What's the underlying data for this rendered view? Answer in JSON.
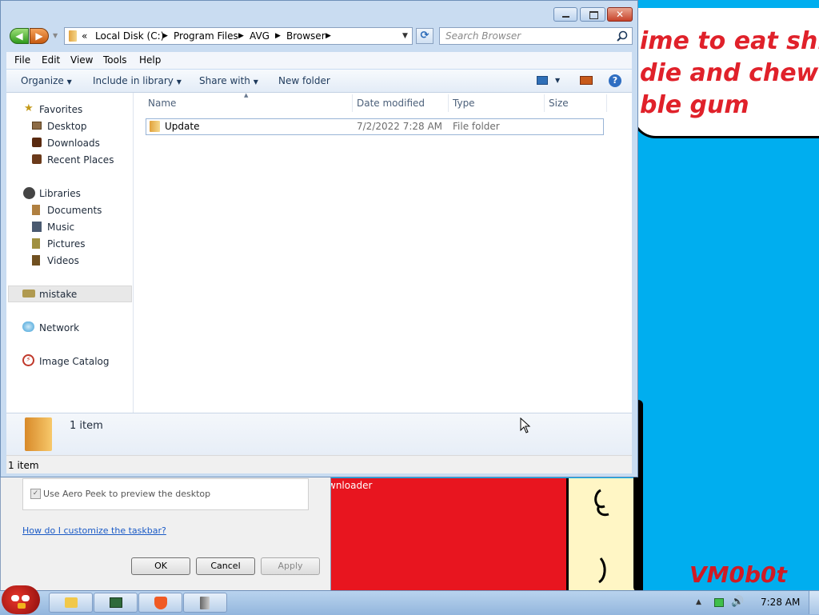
{
  "wallpaper": {
    "lines": "ime to eat shit\ndie and chew\nble gum",
    "watermark": "VM0b0t",
    "bg_window_text": "wnloader"
  },
  "background_dialog": {
    "aero_peek_label": "Use Aero Peek to preview the desktop",
    "help_link": "How do I customize the taskbar?",
    "ok": "OK",
    "cancel": "Cancel",
    "apply": "Apply"
  },
  "explorer": {
    "breadcrumb": {
      "overflow": "«",
      "parts": [
        "Local Disk (C:)",
        "Program Files",
        "AVG",
        "Browser"
      ]
    },
    "search_placeholder": "Search Browser",
    "menu": [
      "File",
      "Edit",
      "View",
      "Tools",
      "Help"
    ],
    "commands": {
      "organize": "Organize",
      "include_in_library": "Include in library",
      "share_with": "Share with",
      "new_folder": "New folder"
    },
    "nav": {
      "favorites": "Favorites",
      "desktop": "Desktop",
      "downloads": "Downloads",
      "recent_places": "Recent Places",
      "libraries": "Libraries",
      "documents": "Documents",
      "music": "Music",
      "pictures": "Pictures",
      "videos": "Videos",
      "homegroup": "mistake",
      "network": "Network",
      "image_catalog": "Image Catalog"
    },
    "columns": {
      "name": "Name",
      "date_modified": "Date modified",
      "type": "Type",
      "size": "Size"
    },
    "files": [
      {
        "name": "Update",
        "date_modified": "7/2/2022 7:28 AM",
        "type": "File folder",
        "size": ""
      }
    ],
    "details_count": "1 item",
    "status_count": "1 item"
  },
  "taskbar": {
    "clock": "7:28 AM"
  }
}
